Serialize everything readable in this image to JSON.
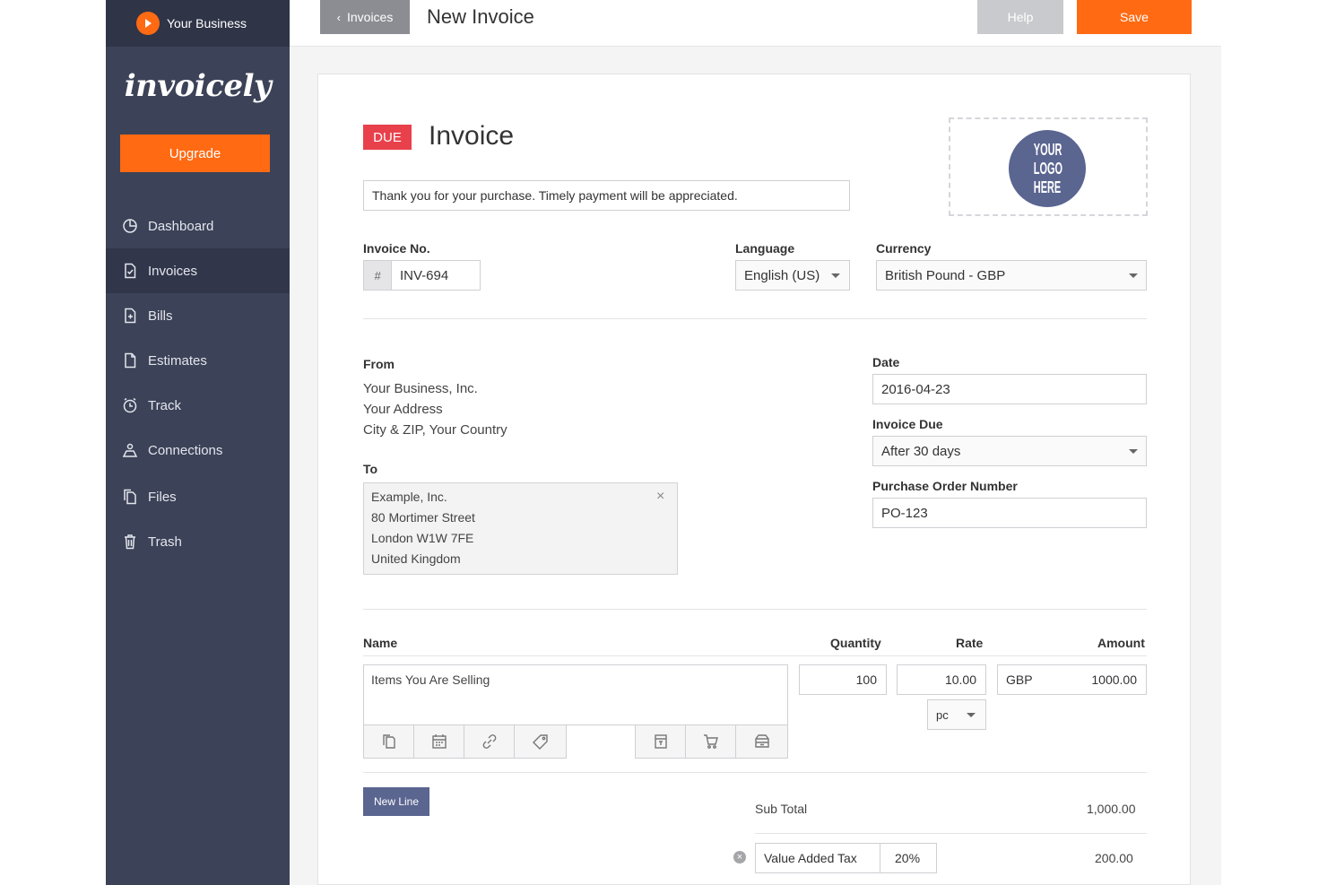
{
  "sidebar": {
    "business_name": "Your Business",
    "brand": "invoicely",
    "upgrade_label": "Upgrade",
    "items": [
      {
        "label": "Dashboard",
        "icon": "dashboard-icon"
      },
      {
        "label": "Invoices",
        "icon": "invoice-icon"
      },
      {
        "label": "Bills",
        "icon": "bill-icon"
      },
      {
        "label": "Estimates",
        "icon": "estimate-icon"
      },
      {
        "label": "Track",
        "icon": "clock-icon"
      },
      {
        "label": "Connections",
        "icon": "connections-icon"
      },
      {
        "label": "Files",
        "icon": "files-icon"
      },
      {
        "label": "Trash",
        "icon": "trash-icon"
      }
    ],
    "active_item": "Invoices"
  },
  "topbar": {
    "back_label": "Invoices",
    "title": "New Invoice",
    "help_label": "Help",
    "save_label": "Save"
  },
  "invoice": {
    "status_badge": "DUE",
    "heading": "Invoice",
    "note": "Thank you for your purchase. Timely payment will be appreciated.",
    "logo_placeholder": [
      "YOUR",
      "LOGO",
      "HERE"
    ],
    "invoice_no_label": "Invoice No.",
    "invoice_no_prefix": "#",
    "invoice_no": "INV-694",
    "language_label": "Language",
    "language": "English (US)",
    "currency_label": "Currency",
    "currency": "British Pound - GBP",
    "from_label": "From",
    "from_lines": [
      "Your Business, Inc.",
      "Your Address",
      "City & ZIP, Your Country"
    ],
    "to_label": "To",
    "to_lines": [
      "Example, Inc.",
      "80 Mortimer Street",
      "London W1W 7FE",
      "United Kingdom"
    ],
    "date_label": "Date",
    "date": "2016-04-23",
    "due_label": "Invoice Due",
    "due": "After 30 days",
    "po_label": "Purchase Order Number",
    "po": "PO-123"
  },
  "items": {
    "headers": {
      "name": "Name",
      "quantity": "Quantity",
      "rate": "Rate",
      "amount": "Amount"
    },
    "line": {
      "name": "Items You Are Selling",
      "quantity": "100",
      "rate": "10.00",
      "currency": "GBP",
      "amount": "1000.00",
      "unit": "pc"
    },
    "new_line_label": "New Line"
  },
  "totals": {
    "subtotal_label": "Sub Total",
    "subtotal": "1,000.00",
    "tax_name": "Value Added Tax",
    "tax_rate": "20%",
    "tax_amount": "200.00"
  }
}
